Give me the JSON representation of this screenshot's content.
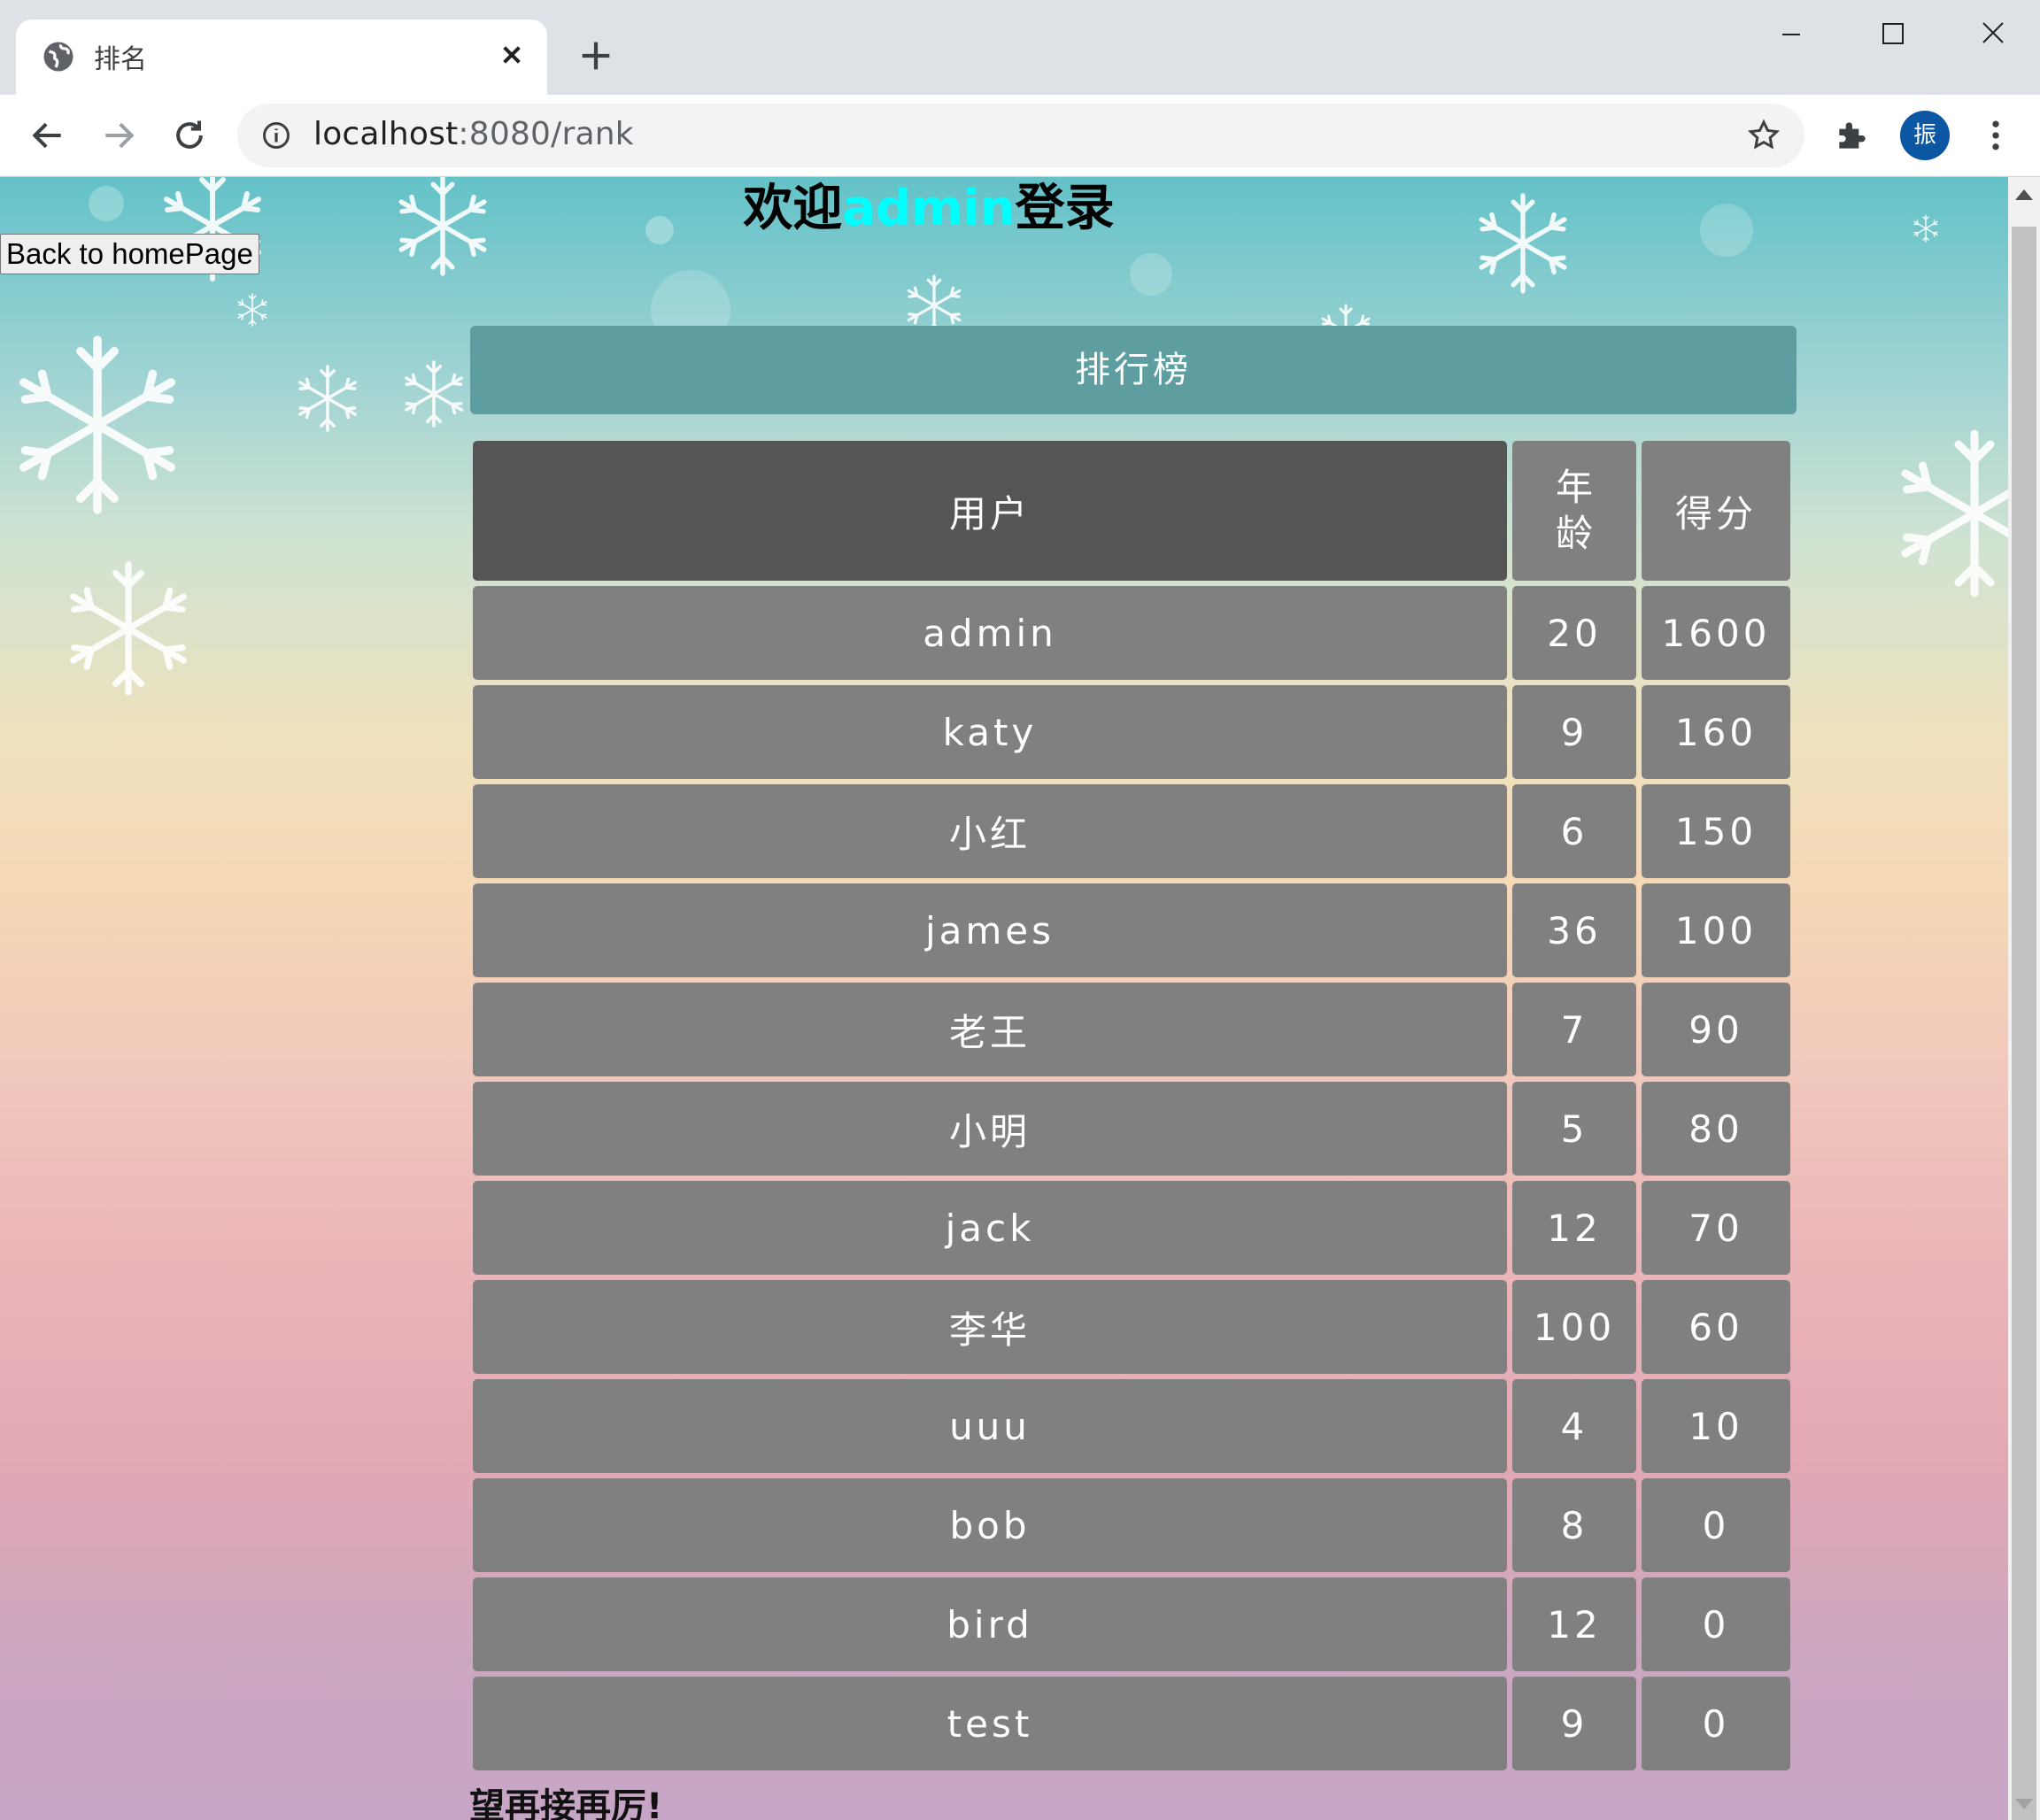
{
  "browser": {
    "tab_title": "排名",
    "url_host": "localhost",
    "url_rest": ":8080/rank",
    "profile_initial": "振"
  },
  "page": {
    "welcome_prefix": "欢迎",
    "welcome_user": "admin",
    "welcome_suffix": "登录",
    "back_button": "Back to homePage",
    "rank_title": "排行榜",
    "columns": [
      "用户",
      "年龄",
      "得分"
    ],
    "rows": [
      {
        "user": "admin",
        "age": "20",
        "score": "1600"
      },
      {
        "user": "katy",
        "age": "9",
        "score": "160"
      },
      {
        "user": "小红",
        "age": "6",
        "score": "150"
      },
      {
        "user": "james",
        "age": "36",
        "score": "100"
      },
      {
        "user": "老王",
        "age": "7",
        "score": "90"
      },
      {
        "user": "小明",
        "age": "5",
        "score": "80"
      },
      {
        "user": "jack",
        "age": "12",
        "score": "70"
      },
      {
        "user": "李华",
        "age": "100",
        "score": "60"
      },
      {
        "user": "uuu",
        "age": "4",
        "score": "10"
      },
      {
        "user": "bob",
        "age": "8",
        "score": "0"
      },
      {
        "user": "bird",
        "age": "12",
        "score": "0"
      },
      {
        "user": "test",
        "age": "9",
        "score": "0"
      }
    ],
    "footer": "望再接再厉!"
  },
  "colors": {
    "header_bar": "#5f9ea0",
    "cell_bg": "#808080",
    "user_header_bg": "#555555",
    "welcome_user_color": "#00ffff"
  }
}
